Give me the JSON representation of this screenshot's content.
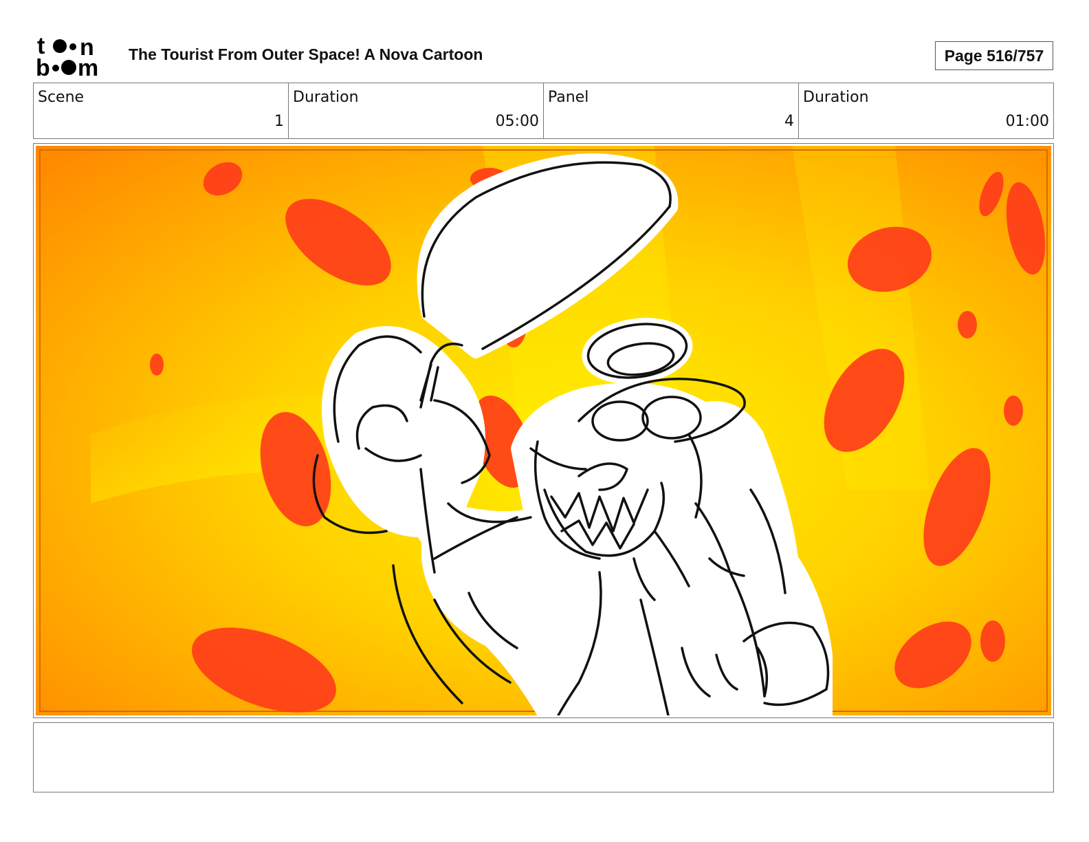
{
  "header": {
    "logo_text": "toon boom",
    "title": "The Tourist From Outer Space!  A Nova Cartoon",
    "page": "Page 516/757"
  },
  "info": {
    "scene_label": "Scene",
    "scene_value": "1",
    "scene_duration_label": "Duration",
    "scene_duration_value": "05:00",
    "panel_label": "Panel",
    "panel_value": "4",
    "panel_duration_label": "Duration",
    "panel_duration_value": "01:00"
  },
  "panel": {
    "bg_center": "#ffee00",
    "bg_edge": "#ff8a00",
    "blob_color": "#ff3a1a",
    "line_color": "#111111"
  },
  "notes": {
    "text": ""
  }
}
